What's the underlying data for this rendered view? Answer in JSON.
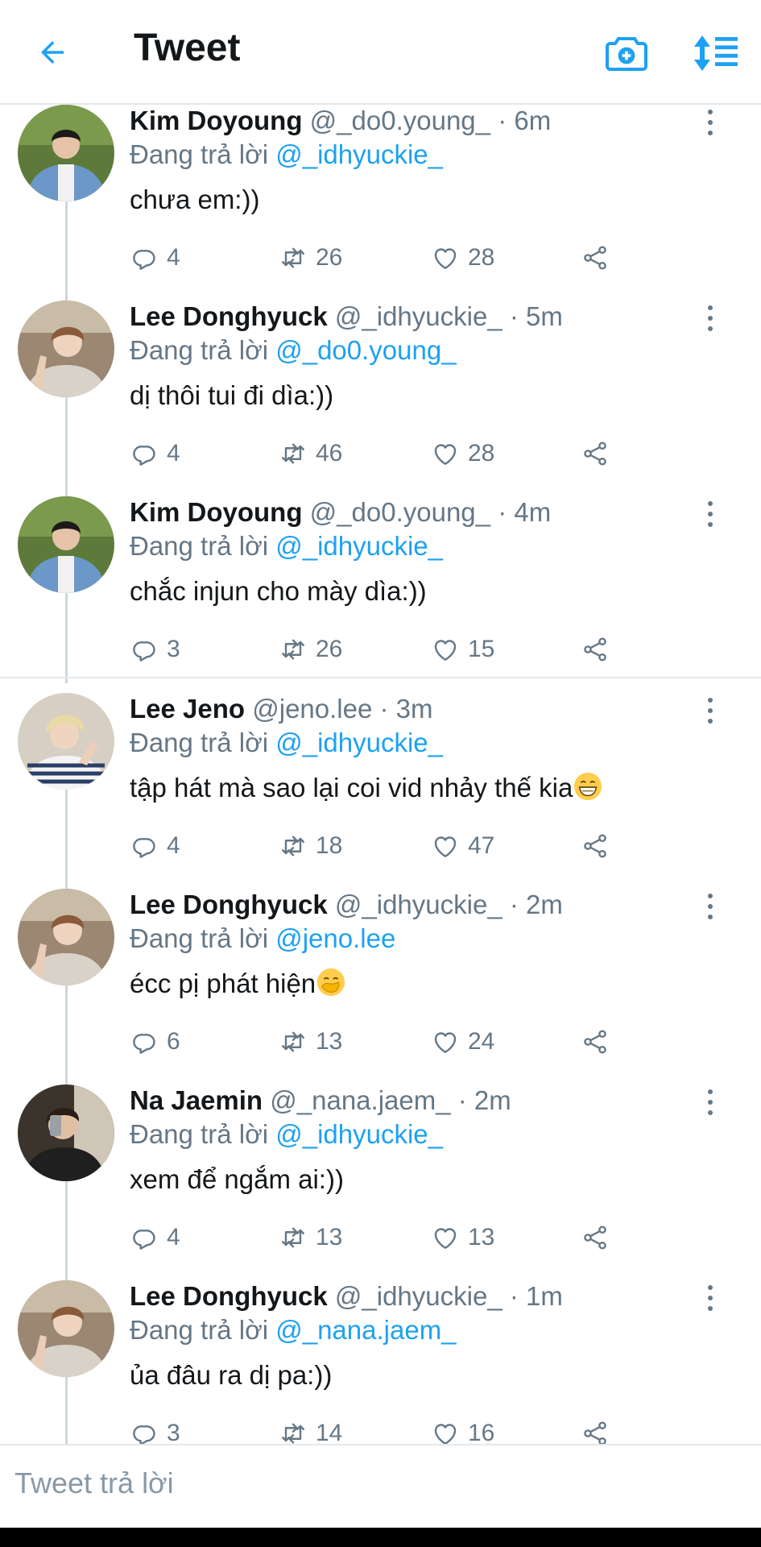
{
  "header": {
    "title": "Tweet",
    "back_icon": "arrow-left-icon",
    "camera_icon": "camera-plus-icon",
    "sort_icon": "sort-icon",
    "accent": "#1da1f2"
  },
  "reply_prefix": "Đang trả lời",
  "tweets": [
    {
      "name": "Kim Doyoung",
      "handle": "@_do0.young_",
      "time": "· 6m",
      "reply_to": "@_idhyuckie_",
      "text": "chưa em:))",
      "replies": "4",
      "retweets": "26",
      "likes": "28"
    },
    {
      "name": "Lee Donghyuck",
      "handle": "@_idhyuckie_",
      "time": "· 5m",
      "reply_to": "@_do0.young_",
      "text": "dị thôi tui đi dìa:))",
      "replies": "4",
      "retweets": "46",
      "likes": "28"
    },
    {
      "name": "Kim Doyoung",
      "handle": "@_do0.young_",
      "time": "· 4m",
      "reply_to": "@_idhyuckie_",
      "text": "chắc injun cho mày dìa:))",
      "replies": "3",
      "retweets": "26",
      "likes": "15"
    },
    {
      "name": "Lee Jeno",
      "handle": "@jeno.lee",
      "time": "· 3m",
      "reply_to": "@_idhyuckie_",
      "text": "tập hát mà sao lại coi vid nhảy thế kia",
      "emoji": "grinning-emoji",
      "replies": "4",
      "retweets": "18",
      "likes": "47"
    },
    {
      "name": "Lee Donghyuck",
      "handle": "@_idhyuckie_",
      "time": "· 2m",
      "reply_to": "@jeno.lee",
      "text": "écc pị phát hiện",
      "emoji": "hand-over-mouth-emoji",
      "replies": "6",
      "retweets": "13",
      "likes": "24"
    },
    {
      "name": "Na Jaemin",
      "handle": "@_nana.jaem_",
      "time": "· 2m",
      "reply_to": "@_idhyuckie_",
      "text": "xem để ngắm ai:))",
      "replies": "4",
      "retweets": "13",
      "likes": "13"
    },
    {
      "name": "Lee Donghyuck",
      "handle": "@_idhyuckie_",
      "time": "· 1m",
      "reply_to": "@_nana.jaem_",
      "text": "ủa đâu ra dị pa:))",
      "replies": "3",
      "retweets": "14",
      "likes": "16"
    }
  ],
  "composer": {
    "placeholder": "Tweet trả lời"
  }
}
